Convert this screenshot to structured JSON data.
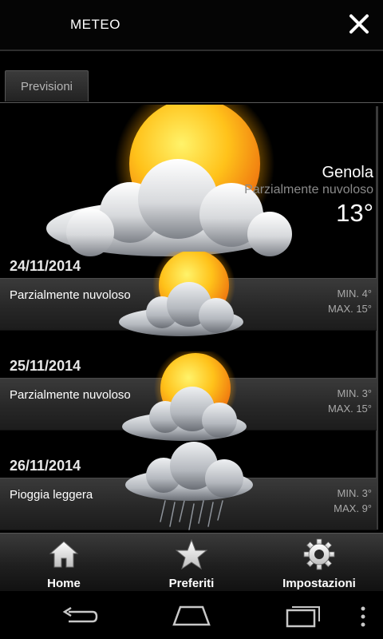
{
  "header": {
    "title": "METEO"
  },
  "tabs": [
    {
      "label": "Previsioni"
    }
  ],
  "current": {
    "city": "Genola",
    "condition": "Parzialmente nuvoloso",
    "temperature": "13°"
  },
  "days": [
    {
      "date": "24/11/2014",
      "condition": "Parzialmente nuvoloso",
      "min": "MIN. 4°",
      "max": "MAX. 15°",
      "icon": "partly-cloudy-icon"
    },
    {
      "date": "25/11/2014",
      "condition": "Parzialmente nuvoloso",
      "min": "MIN. 3°",
      "max": "MAX. 15°",
      "icon": "partly-cloudy-icon"
    },
    {
      "date": "26/11/2014",
      "condition": "Pioggia leggera",
      "min": "MIN. 3°",
      "max": "MAX. 9°",
      "icon": "light-rain-icon"
    }
  ],
  "nav": [
    {
      "label": "Home",
      "icon": "home-icon"
    },
    {
      "label": "Preferiti",
      "icon": "star-icon"
    },
    {
      "label": "Impostazioni",
      "icon": "gear-icon"
    }
  ],
  "system_nav": {
    "icons": [
      "back-icon",
      "home-outline-icon",
      "recent-apps-icon",
      "overflow-menu-icon"
    ]
  },
  "colors": {
    "background": "#000000",
    "band": "#2e2e2e",
    "sun": "#ffc21a",
    "text_muted": "#8a8a8a"
  }
}
